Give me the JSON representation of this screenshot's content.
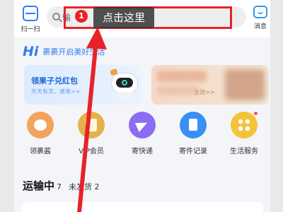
{
  "topbar": {
    "scan_label": "扫一扫",
    "search_placeholder": "输",
    "messages_label": "消息"
  },
  "slogan": {
    "hi": "Hi",
    "text": "裹裹开启美好生活"
  },
  "banners": {
    "left_title": "领果子兑红包",
    "left_subtitle": "天天有奖，速来>>",
    "right_subtitle": "上池>>"
  },
  "services": [
    {
      "label": "领裹酱",
      "icon": "smile-bag-icon"
    },
    {
      "label": "VIP会员",
      "icon": "crown-icon"
    },
    {
      "label": "寄快递",
      "icon": "paper-plane-icon"
    },
    {
      "label": "寄件记录",
      "icon": "clipboard-icon"
    },
    {
      "label": "生活服务",
      "icon": "grid-dots-icon"
    }
  ],
  "status_tabs": {
    "active_label": "运输中",
    "active_count": "7",
    "other_label": "未发货",
    "other_count": "2"
  },
  "annotation": {
    "step": "1",
    "tooltip": "点击这里",
    "color": "#e8222a"
  }
}
